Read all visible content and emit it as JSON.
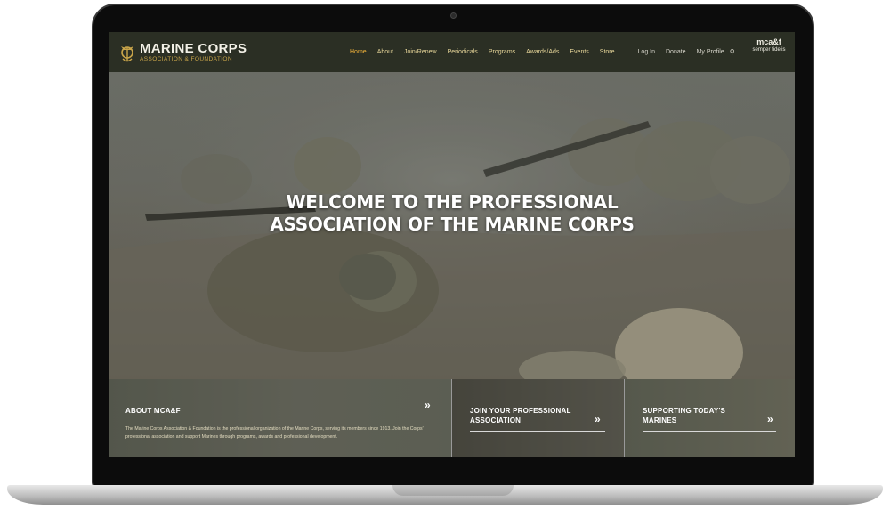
{
  "site": {
    "logo": {
      "title": "MARINE CORPS",
      "subtitle": "ASSOCIATION & FOUNDATION",
      "badge_line1": "mca&f",
      "badge_line2": "semper fidelis"
    },
    "nav": [
      "Home",
      "About",
      "Join/Renew",
      "Periodicals",
      "Programs",
      "Awards/Ads",
      "Events",
      "Store"
    ],
    "nav_active_index": 0,
    "utility": [
      "Log In",
      "Donate",
      "My Profile"
    ],
    "search_icon": "search-icon"
  },
  "hero": {
    "title_line1": "WELCOME TO THE PROFESSIONAL",
    "title_line2": "ASSOCIATION OF THE MARINE CORPS"
  },
  "panels": {
    "about": {
      "title": "ABOUT MCA&F",
      "body": "The Marine Corps Association & Foundation is the professional organization of the Marine Corps, serving its members since 1913. Join the Corps' professional association and support Marines through programs, awards and professional development."
    },
    "join": {
      "title_line1": "JOIN YOUR PROFESSIONAL",
      "title_line2": "ASSOCIATION"
    },
    "support": {
      "title_line1": "SUPPORTING TODAY'S",
      "title_line2": "MARINES"
    },
    "arrow_glyph": "»"
  },
  "colors": {
    "header_bg": "#2b2f24",
    "nav_text": "#e8d79a",
    "nav_active": "#f0b23a",
    "logo_gold": "#c9a54a"
  }
}
